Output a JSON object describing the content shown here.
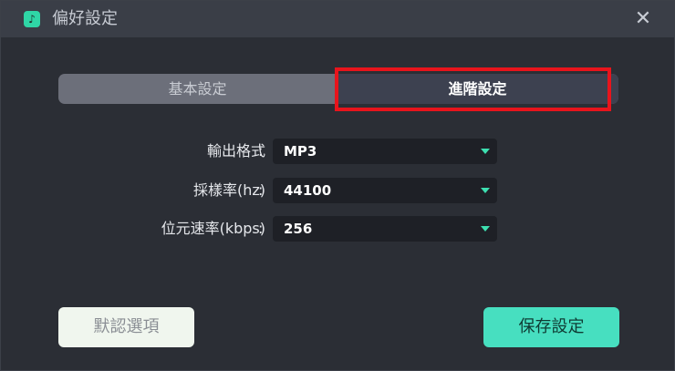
{
  "window": {
    "title": "偏好設定",
    "close_symbol": "✕",
    "app_icon": "music-note-icon"
  },
  "tabs": [
    {
      "label": "基本設定",
      "active": false
    },
    {
      "label": "進階設定",
      "active": true
    }
  ],
  "settings": [
    {
      "label": "輸出格式",
      "value": "MP3"
    },
    {
      "label": "採樣率(hz)",
      "value": "44100"
    },
    {
      "label": "位元速率(kbps)",
      "value": "256"
    }
  ],
  "colon": ":",
  "buttons": {
    "reset_label": "默認選項",
    "save_label": "保存設定"
  },
  "colors": {
    "accent": "#47dfc0",
    "highlight": "#e8141c",
    "background": "#2b2e35",
    "titlebar": "#3a3e47"
  }
}
